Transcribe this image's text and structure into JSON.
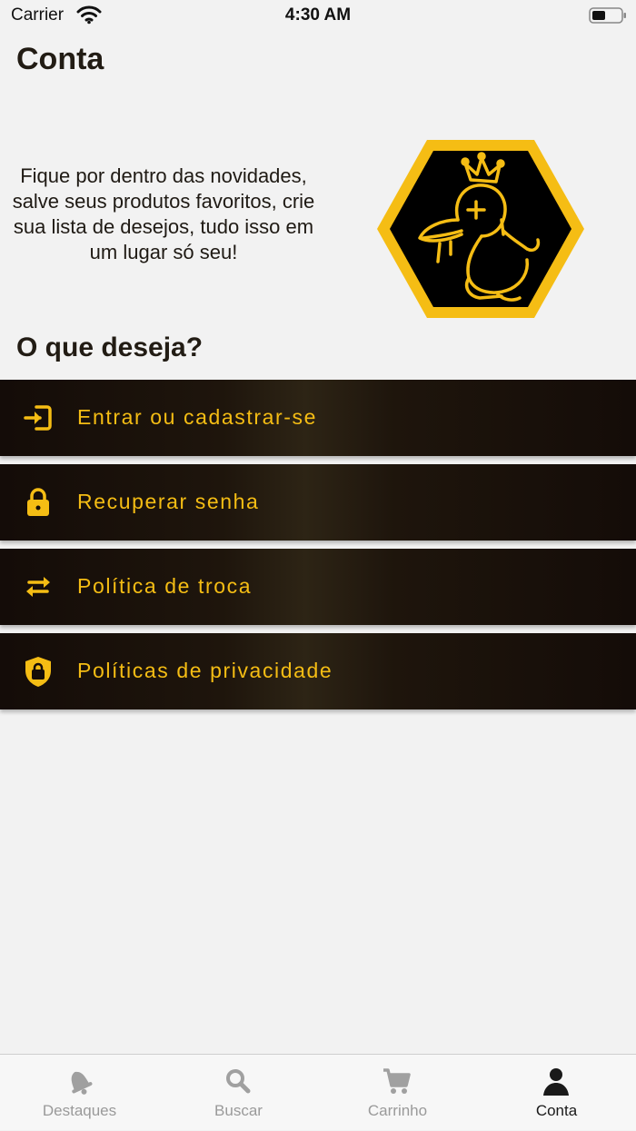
{
  "status_bar": {
    "carrier": "Carrier",
    "time": "4:30 AM",
    "icons": [
      "wifi-icon",
      "battery-icon"
    ]
  },
  "header": {
    "title": "Conta"
  },
  "intro": {
    "text": "Fique por dentro das novidades, salve seus produtos favoritos, crie sua lista de desejos, tudo isso em um lugar só seu!"
  },
  "logo": {
    "icon": "duck-crown-hexagon-logo",
    "colors": {
      "fill": "#000000",
      "accent": "#f5bd14"
    }
  },
  "section": {
    "title": "O que deseja?"
  },
  "menu": {
    "items": [
      {
        "label": "Entrar ou cadastrar-se",
        "icon": "sign-in-icon"
      },
      {
        "label": "Recuperar senha",
        "icon": "lock-icon"
      },
      {
        "label": "Política de troca",
        "icon": "swap-arrows-icon"
      },
      {
        "label": "Políticas de privacidade",
        "icon": "shield-lock-icon"
      }
    ],
    "accent_color": "#f5bd14"
  },
  "tabbar": {
    "tabs": [
      {
        "label": "Destaques",
        "icon": "bell-icon",
        "active": false
      },
      {
        "label": "Buscar",
        "icon": "search-icon",
        "active": false
      },
      {
        "label": "Carrinho",
        "icon": "cart-icon",
        "active": false
      },
      {
        "label": "Conta",
        "icon": "user-icon",
        "active": true
      }
    ]
  }
}
